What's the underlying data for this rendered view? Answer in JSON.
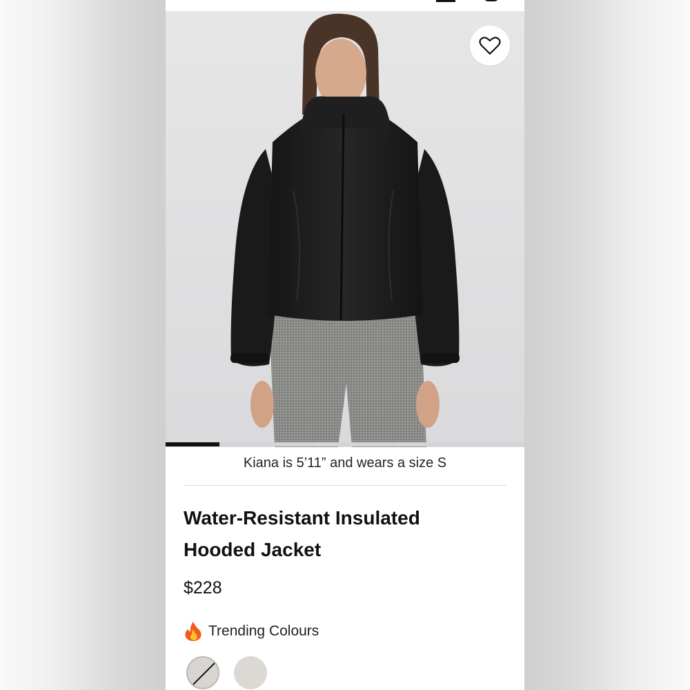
{
  "product": {
    "model_note": "Kiana is 5’11” and wears a size S",
    "title": "Water-Resistant Insulated Hooded Jacket",
    "price": "$228",
    "trending_label": "Trending Colours",
    "trending_icon": "flame-icon",
    "favorite_icon": "heart-icon"
  },
  "gallery": {
    "progress_fraction": 0.15
  },
  "swatches": [
    {
      "name": "light-stone",
      "color": "#d9d6d2",
      "unavailable": true
    },
    {
      "name": "light-grey",
      "color": "#dcd8d4",
      "unavailable": false
    }
  ],
  "colors": {
    "accent": "#111111",
    "background": "#ffffff",
    "jacket": "#1c1c1c",
    "pants": "#8a8a88"
  }
}
